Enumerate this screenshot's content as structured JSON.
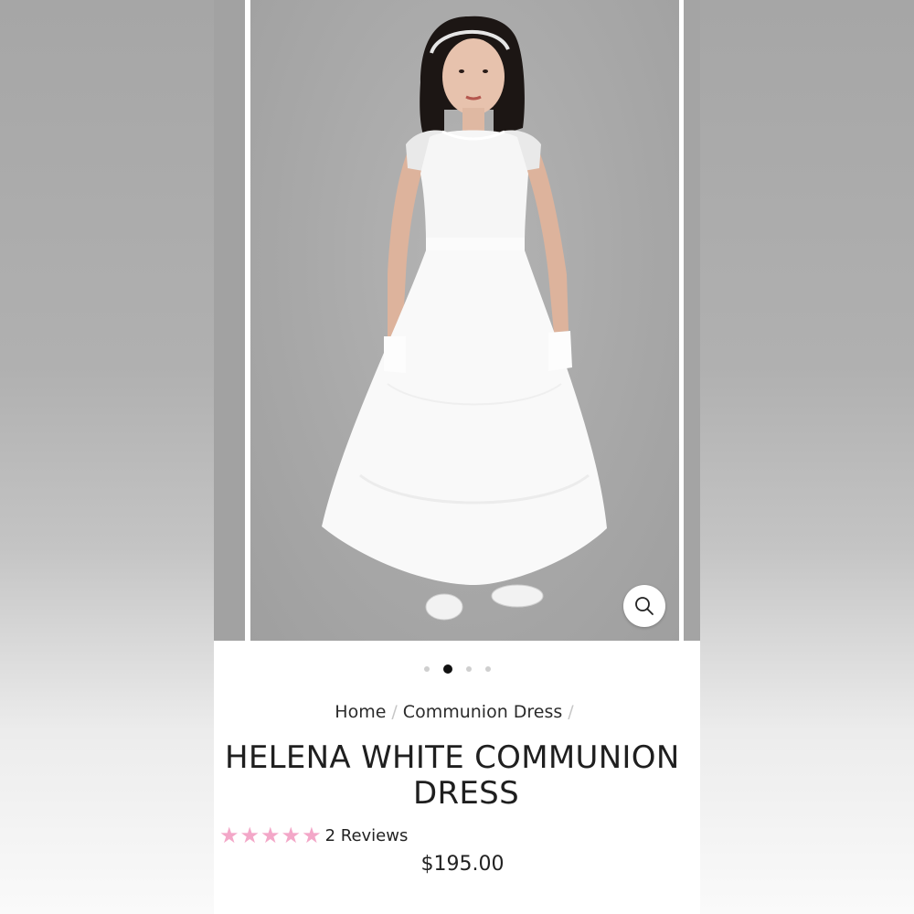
{
  "carousel": {
    "slide_count": 4,
    "active_index": 1,
    "zoom_icon": "search-icon"
  },
  "breadcrumb": {
    "items": [
      "Home",
      "Communion Dress"
    ],
    "separator": "/"
  },
  "product": {
    "title_line1": "HELENA WHITE COMMUNION",
    "title_line2": "DRESS",
    "rating": 5,
    "rating_max": 5,
    "reviews_label": "2 Reviews",
    "price": "$195.00"
  },
  "colors": {
    "star": "#f3a7c8",
    "text": "#222222",
    "active_dot": "#111111",
    "inactive_dot": "#cfcfcf"
  }
}
